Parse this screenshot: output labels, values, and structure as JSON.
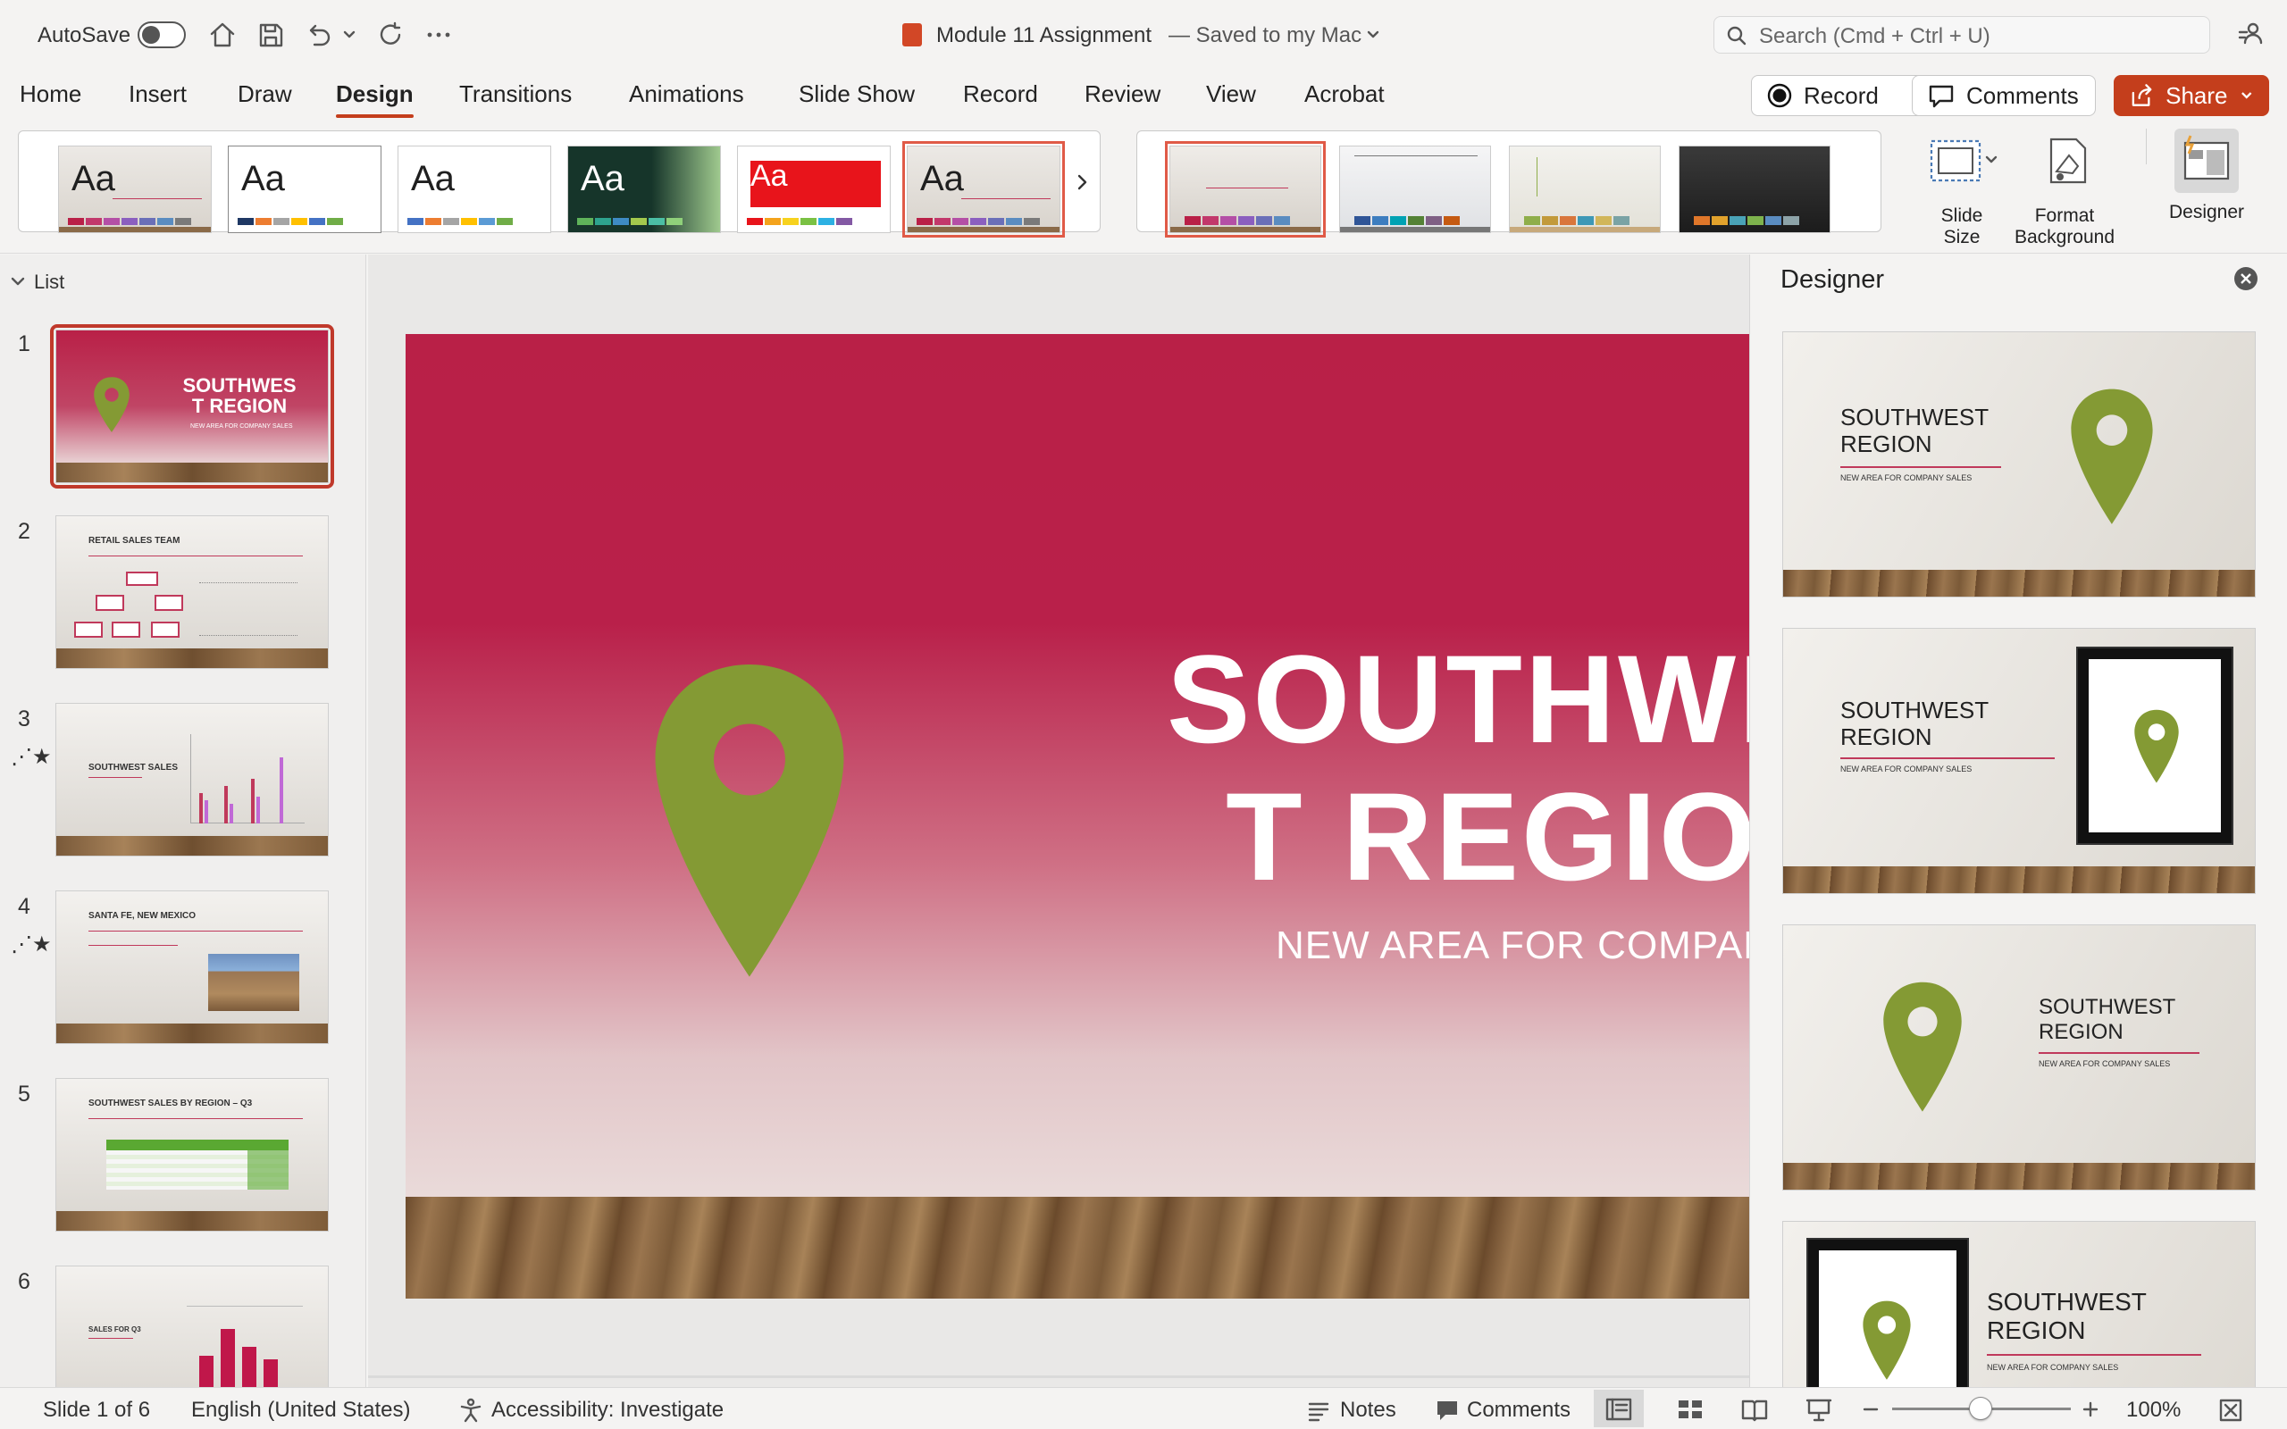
{
  "titlebar": {
    "autosave_label": "AutoSave",
    "doc_title": "Module 11 Assignment",
    "save_status": "— Saved to my Mac",
    "search_placeholder": "Search (Cmd + Ctrl + U)"
  },
  "tabs": [
    "Home",
    "Insert",
    "Draw",
    "Design",
    "Transitions",
    "Animations",
    "Slide Show",
    "Record",
    "Review",
    "View",
    "Acrobat"
  ],
  "active_tab": "Design",
  "actions": {
    "record": "Record",
    "comments": "Comments",
    "share": "Share"
  },
  "ribbon": {
    "theme_sample": "Aa",
    "slide_size": [
      "Slide",
      "Size"
    ],
    "format_background": [
      "Format",
      "Background"
    ],
    "designer": "Designer"
  },
  "slides_panel": {
    "header": "List",
    "slides": [
      {
        "num": "1",
        "title": "SOUTHWEST REGION",
        "subtitle": "NEW AREA FOR COMPANY SALES"
      },
      {
        "num": "2",
        "title": "RETAIL SALES TEAM"
      },
      {
        "num": "3",
        "title": "SOUTHWEST SALES"
      },
      {
        "num": "4",
        "title": "SANTA FE, NEW MEXICO"
      },
      {
        "num": "5",
        "title": "SOUTHWEST SALES BY REGION – Q3"
      },
      {
        "num": "6",
        "title": "SALES FOR Q3"
      }
    ]
  },
  "slide": {
    "title_line1": "SOUTHWES",
    "title_line2": "T REGION",
    "subtitle": "NEW AREA FOR COMPANY SALES"
  },
  "designer": {
    "title": "Designer",
    "card_title_line1": "SOUTHWEST",
    "card_title_line2": "REGION",
    "card_subtitle": "NEW AREA FOR COMPANY SALES"
  },
  "statusbar": {
    "slide_info": "Slide 1 of 6",
    "language": "English (United States)",
    "accessibility": "Accessibility: Investigate",
    "notes": "Notes",
    "comments": "Comments",
    "zoom": "100%"
  },
  "colors": {
    "accent": "#c43e1c",
    "slide_primary": "#b92047",
    "pin": "#849a34"
  }
}
